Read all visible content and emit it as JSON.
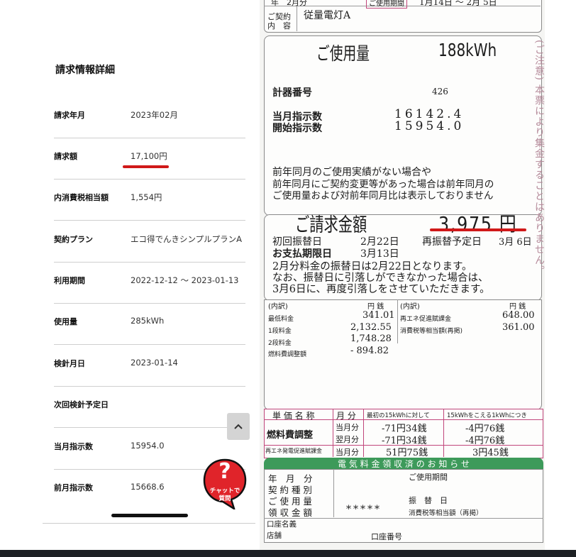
{
  "detail": {
    "title": "請求情報詳細",
    "rows": [
      {
        "label": "請求年月",
        "value": "2023年02月"
      },
      {
        "label": "請求額",
        "value": "17,100円"
      },
      {
        "label": "内消費税相当額",
        "value": "1,554円"
      },
      {
        "label": "契約プラン",
        "value": "エコ得でんきシンプルプランA"
      },
      {
        "label": "利用期間",
        "value": "2022-12-12 ～  2023-01-13"
      },
      {
        "label": "使用量",
        "value": "285kWh"
      },
      {
        "label": "検針月日",
        "value": "2023-01-14"
      },
      {
        "label": "次回検針予定日",
        "value": ""
      },
      {
        "label": "当月指示数",
        "value": "15954.0"
      },
      {
        "label": "前月指示数",
        "value": "15668.6"
      }
    ],
    "chat_label_1": "チャットで",
    "chat_label_2": "質問",
    "chat_q": "?"
  },
  "bill": {
    "top_header_1": "年　2月分",
    "top_header_2": "ご使用期間",
    "top_header_3": "1月14日 ～ 2月 5日",
    "contract_label_1": "ご契約",
    "contract_label_2": "内　容",
    "contract_value": "従量電灯A",
    "usage_label": "ご使用量",
    "usage_value": "188kWh",
    "meter_no_label": "計器番号",
    "meter_no_value": "426",
    "current_reading_label": "当月指示数",
    "current_reading_value": "16142.4",
    "start_reading_label": "開始指示数",
    "start_reading_value": "15954.0",
    "note_1": "前年同月のご使用実績がない場合や",
    "note_2": "前年同月にご契約変更等があった場合は前年同月の",
    "note_3": "ご使用量および対前年同月比は表示しておりません",
    "billing_label": "ご請求金額",
    "billing_value": "3,975 円",
    "first_transfer_label": "初回振替日",
    "first_transfer_value": "2月22日",
    "next_transfer_label": "再振替予定日",
    "next_transfer_value": "3月 6日",
    "due_label": "お支払期限日",
    "due_value": "3月13日",
    "notice_1": "2月分料金の振替日は2月22日となります。",
    "notice_2": "なお、振替日に引落しができなかった場合は、",
    "notice_3": "3月6日に、再度引落しをさせていただきます。",
    "breakdown_label": "(内訳)",
    "yen_label": "円 銭",
    "breakdown_left": [
      {
        "label": "最低料金",
        "value": "341.01"
      },
      {
        "label": "1段料金",
        "value": "2,132.55"
      },
      {
        "label": "2段料金",
        "value": "1,748.28"
      },
      {
        "label": "燃料費調整額",
        "value": "- 894.82"
      }
    ],
    "breakdown_right": [
      {
        "label": "再エネ促進賦課金",
        "value": "648.00"
      },
      {
        "label": "消費税等相当額(再掲)",
        "value": "361.00"
      }
    ],
    "side_note": "(ご注意) 本票により集金することはありません。",
    "unit_table": {
      "h1": "単 価 名 称",
      "h2": "月 分",
      "h3": "最初の15kWhに対して",
      "h4": "15kWhをこえる1kWhにつき",
      "fuel_label": "燃料費調整",
      "fuel_rows": [
        {
          "month": "当月分",
          "a": "-71円34銭",
          "b": "-4円76銭"
        },
        {
          "month": "翌月分",
          "a": "-71円34銭",
          "b": "-4円76銭"
        }
      ],
      "renew_label": "再エネ発電促進賦課金",
      "renew_row": {
        "month": "当月分",
        "a": "51円75銭",
        "b": "3円45銭"
      }
    },
    "receipt_banner": "電 気 料 金 領 収 済 の お 知 ら せ",
    "receipt_left": [
      "年　月　分",
      "契 約 種 別",
      "ご 使 用 量",
      "領 収 金 額"
    ],
    "receipt_period": "ご使用期間",
    "receipt_transfer": "振　替　日",
    "receipt_stars": "*****",
    "receipt_tax": "消費税等相当額（再掲）",
    "account_name": "口座名義",
    "branch": "店舗",
    "account_no": "口座番号"
  },
  "colors": {
    "accent_red": "#d01919",
    "chat_red": "#e0242a",
    "receipt_green": "#3d9a5a",
    "bill_pink": "#c0467b"
  }
}
